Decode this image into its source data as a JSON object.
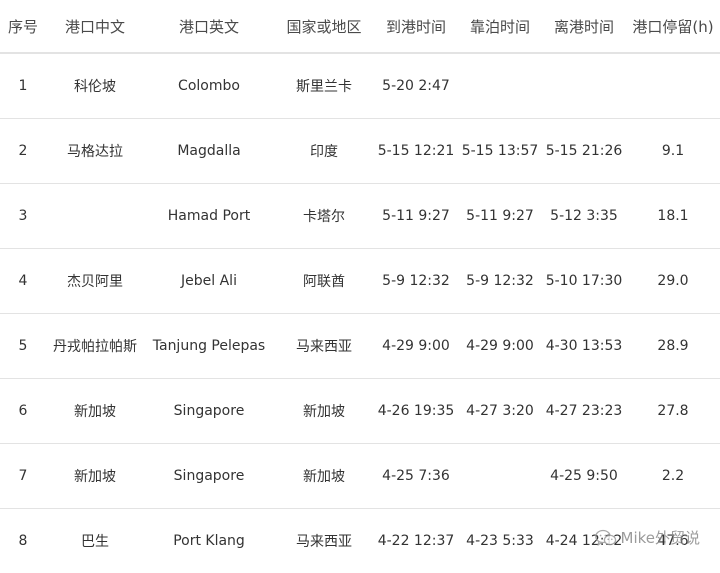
{
  "table": {
    "headers": [
      "序号",
      "港口中文",
      "港口英文",
      "国家或地区",
      "到港时间",
      "靠泊时间",
      "离港时间",
      "港口停留(h)"
    ],
    "rows": [
      [
        "1",
        "科伦坡",
        "Colombo",
        "斯里兰卡",
        "5-20 2:47",
        "",
        "",
        ""
      ],
      [
        "2",
        "马格达拉",
        "Magdalla",
        "印度",
        "5-15 12:21",
        "5-15 13:57",
        "5-15 21:26",
        "9.1"
      ],
      [
        "3",
        "",
        "Hamad Port",
        "卡塔尔",
        "5-11 9:27",
        "5-11 9:27",
        "5-12 3:35",
        "18.1"
      ],
      [
        "4",
        "杰贝阿里",
        "Jebel Ali",
        "阿联酋",
        "5-9 12:32",
        "5-9 12:32",
        "5-10 17:30",
        "29.0"
      ],
      [
        "5",
        "丹戎帕拉帕斯",
        "Tanjung Pelepas",
        "马来西亚",
        "4-29 9:00",
        "4-29 9:00",
        "4-30 13:53",
        "28.9"
      ],
      [
        "6",
        "新加坡",
        "Singapore",
        "新加坡",
        "4-26 19:35",
        "4-27 3:20",
        "4-27 23:23",
        "27.8"
      ],
      [
        "7",
        "新加坡",
        "Singapore",
        "新加坡",
        "4-25 7:36",
        "",
        "4-25 9:50",
        "2.2"
      ],
      [
        "8",
        "巴生",
        "Port Klang",
        "马来西亚",
        "4-22 12:37",
        "4-23 5:33",
        "4-24 12:12",
        "47.6"
      ]
    ]
  },
  "watermark": {
    "text": "Mike外贸说",
    "icon": "wechat-icon"
  }
}
